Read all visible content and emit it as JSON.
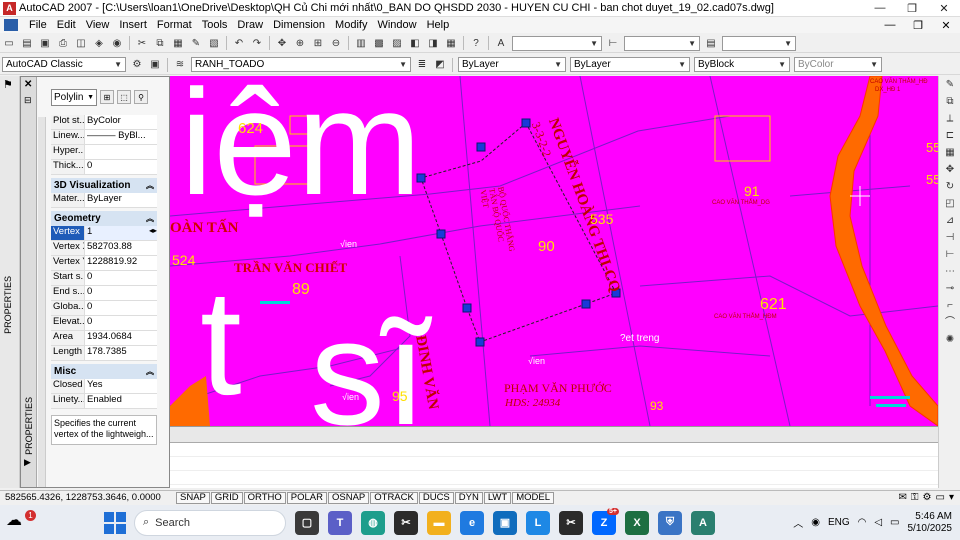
{
  "window": {
    "app_name": "AutoCAD 2007",
    "title": "AutoCAD 2007 - [C:\\Users\\loan1\\OneDrive\\Desktop\\QH Củ Chi mới nhất\\0_BAN DO QHSDD 2030 - HUYEN CU CHI - ban chot duyet_19_02.cad07s.dwg]",
    "minimize": "—",
    "restore": "❐",
    "close": "✕"
  },
  "menu": {
    "items": [
      "File",
      "Edit",
      "View",
      "Insert",
      "Format",
      "Tools",
      "Draw",
      "Dimension",
      "Modify",
      "Window",
      "Help"
    ],
    "doc_controls": [
      "—",
      "❐",
      "✕"
    ]
  },
  "toolbar2": {
    "workspace": "AutoCAD Classic",
    "layer": "RANH_TOADO",
    "color": "ByLayer",
    "linetype": "ByLayer",
    "lineweight": "ByBlock",
    "plotstyle": "ByColor"
  },
  "left_strip": {
    "label": "PROPERTIES"
  },
  "palette": {
    "close_icon": "✕",
    "vertical_title": "PROPERTIES",
    "object_type": "Polylin",
    "general_rows": [
      {
        "key": "Plot st...",
        "value": "ByColor"
      },
      {
        "key": "Linew...",
        "value": "——— ByBl..."
      },
      {
        "key": "Hyper...",
        "value": ""
      },
      {
        "key": "Thick...",
        "value": "0"
      }
    ],
    "viz_header": "3D Visualization",
    "viz_rows": [
      {
        "key": "Mater...",
        "value": "ByLayer"
      }
    ],
    "geometry_header": "Geometry",
    "geometry_rows": [
      {
        "key": "Vertex",
        "value": "1"
      },
      {
        "key": "Vertex X",
        "value": "582703.88"
      },
      {
        "key": "Vertex Y",
        "value": "1228819.92"
      },
      {
        "key": "Start s...",
        "value": "0"
      },
      {
        "key": "End s...",
        "value": "0"
      },
      {
        "key": "Globa...",
        "value": "0"
      },
      {
        "key": "Elevat...",
        "value": "0"
      },
      {
        "key": "Area",
        "value": "1934.0684"
      },
      {
        "key": "Length",
        "value": "178.7385"
      }
    ],
    "misc_header": "Misc",
    "misc_rows": [
      {
        "key": "Closed",
        "value": "Yes"
      },
      {
        "key": "Linety...",
        "value": "Enabled"
      }
    ],
    "description": "Specifies the current vertex of the lightweigh..."
  },
  "drawing": {
    "big_text_1": "iệm",
    "big_text_2": "t",
    "big_text_3": "sĩ",
    "labels": {
      "hoan_tan": "OÀN TẤN",
      "tran_van_chiet": "TRẦN VĂN CHIẾT",
      "nguyen_hoang": "NGUYỄN HOÀNG THI-CQ",
      "nguyen_hoang_code": "3-3-2-2",
      "dinh_van": "ĐINH VĂN",
      "pham_van_phuoc": "PHẠM VĂN PHƯỚC",
      "hd": "HDS: 24934",
      "bo_quoc": "BỘ QUỐC THẮNG TÂN BỘ QUỐC VIỆT",
      "ret_treng": "?et treng",
      "vien_1": "√ien",
      "vien_2": "√ien",
      "vien_3": "√ien",
      "cao_van_tham_1": "CAO VĂN THẮM_HĐ",
      "cao_van_tham_2": "CAO VĂN THẮM_DG",
      "cao_van_tham_3": "CAO VĂN THẮM_HĐM",
      "dx_hd": "DX_HĐ 1"
    },
    "numbers": {
      "n624": "624",
      "n524": "524",
      "n89": "89",
      "n535": "535",
      "n90": "90",
      "n91": "91",
      "n621": "621",
      "n93": "93",
      "n95": "95",
      "n55a": "55",
      "n55b": "55"
    }
  },
  "statusbar": {
    "coords": "582565.4326, 1228753.3646, 0.0000",
    "toggles": [
      "SNAP",
      "GRID",
      "ORTHO",
      "POLAR",
      "OSNAP",
      "OTRACK",
      "DUCS",
      "DYN",
      "LWT",
      "MODEL"
    ]
  },
  "taskbar": {
    "weather_badge": "1",
    "search_label": "Search",
    "zalo_badge": "5+",
    "lang": "ENG",
    "time": "5:46 AM",
    "date": "5/10/2025"
  },
  "colors": {
    "canvas_bg": "#ff00ff",
    "selection_grip": "#1a3ad8",
    "orange_road": "#ff6a00"
  }
}
